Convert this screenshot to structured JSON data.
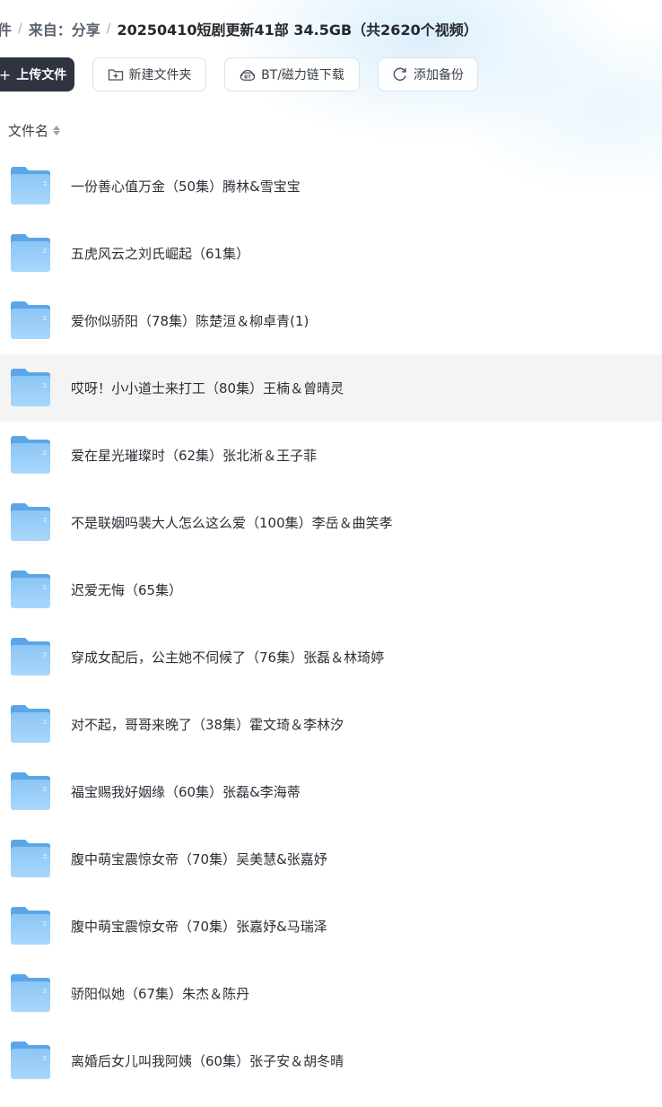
{
  "breadcrumb": {
    "items": [
      "件",
      "来自：分享"
    ],
    "current": "20250410短剧更新41部 34.5GB（共2620个视频）"
  },
  "toolbar": {
    "upload_label": "上传文件",
    "new_folder_label": "新建文件夹",
    "bt_label": "BT/磁力链下载",
    "backup_label": "添加备份"
  },
  "columns": {
    "name_header": "文件名"
  },
  "colors": {
    "folder_light": "#9ed0f7",
    "folder_dark": "#5aa6e8",
    "highlight_row": "#f4f4f5",
    "primary_button": "#2f3342"
  },
  "files": [
    {
      "name": "一份善心值万金（50集）腾林&雪宝宝",
      "icon": "folder-icon"
    },
    {
      "name": "五虎风云之刘氏崛起（61集）",
      "icon": "folder-icon"
    },
    {
      "name": "爱你似骄阳（78集）陈楚洹＆柳卓青(1)",
      "icon": "folder-icon"
    },
    {
      "name": "哎呀！小小道士来打工（80集）王楠＆曾晴灵",
      "icon": "folder-icon",
      "highlighted": true
    },
    {
      "name": "爱在星光璀璨时（62集）张北淅＆王子菲",
      "icon": "folder-icon"
    },
    {
      "name": "不是联姻吗裴大人怎么这么爱（100集）李岳＆曲笑孝",
      "icon": "folder-icon"
    },
    {
      "name": "迟爱无悔（65集）",
      "icon": "folder-icon"
    },
    {
      "name": "穿成女配后，公主她不伺候了（76集）张磊＆林琦婷",
      "icon": "folder-icon"
    },
    {
      "name": "对不起，哥哥来晚了（38集）霍文琦＆李林汐",
      "icon": "folder-icon"
    },
    {
      "name": "福宝赐我好姻缘（60集）张磊&李海蒂",
      "icon": "folder-icon"
    },
    {
      "name": "腹中萌宝震惊女帝（70集）吴美慧&张嘉妤",
      "icon": "folder-icon"
    },
    {
      "name": "腹中萌宝震惊女帝（70集）张嘉妤&马瑞泽",
      "icon": "folder-icon"
    },
    {
      "name": "骄阳似她（67集）朱杰＆陈丹",
      "icon": "folder-icon"
    },
    {
      "name": "离婚后女儿叫我阿姨（60集）张子安＆胡冬晴",
      "icon": "folder-icon"
    }
  ]
}
